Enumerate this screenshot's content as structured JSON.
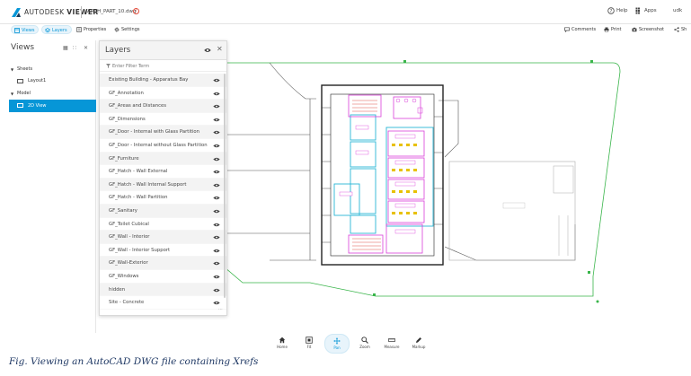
{
  "app": {
    "brand_prefix": "AUTODESK",
    "brand_suffix": "VIEWER",
    "filename": "ARCH_PART_10.dwg",
    "help_label": "Help",
    "apps_label": "Apps",
    "user_label": "udk"
  },
  "toolbar": {
    "views_label": "Views",
    "layers_label": "Layers",
    "properties_label": "Properties",
    "settings_label": "Settings",
    "comments_label": "Comments",
    "print_label": "Print",
    "screenshot_label": "Screenshot",
    "share_label": "Sh"
  },
  "views_panel": {
    "title": "Views",
    "sheets_label": "Sheets",
    "layout_label": "Layout1",
    "model_label": "Model",
    "view_2d_label": "2D View"
  },
  "layers_panel": {
    "title": "Layers",
    "filter_placeholder": "Enter Filter Term",
    "layers": [
      "Existing Building - Apparatus Bay",
      "GF_Annotation",
      "GF_Areas and Distances",
      "GF_Dimensions",
      "GF_Door - Internal with Glass Partition",
      "GF_Door - Internal without Glass Partition",
      "GF_Furniture",
      "GF_Hatch - Wall External",
      "GF_Hatch - Wall Internal Support",
      "GF_Hatch - Wall Partition",
      "GF_Sanitary",
      "GF_Toilet Cubical",
      "GF_Wall - Interior",
      "GF_Wall - Interior Support",
      "GF_Wall-Exterior",
      "GF_Windows",
      "hidden",
      "Site - Concrete"
    ]
  },
  "bottom_nav": {
    "home_label": "Home",
    "fit_label": "Fit",
    "pan_label": "Pan",
    "zoom_label": "Zoom",
    "measure_label": "Measure",
    "markup_label": "Markup"
  },
  "caption": "Fig. Viewing an AutoCAD DWG file containing Xrefs",
  "colors": {
    "accent": "#0696d7",
    "site_boundary": "#39b54a",
    "plan_lines": "#222222",
    "room_magenta": "#d93fd9",
    "room_cyan": "#29b6d6",
    "hatch_red": "#e0524a",
    "furniture_yellow": "#e8c100"
  }
}
